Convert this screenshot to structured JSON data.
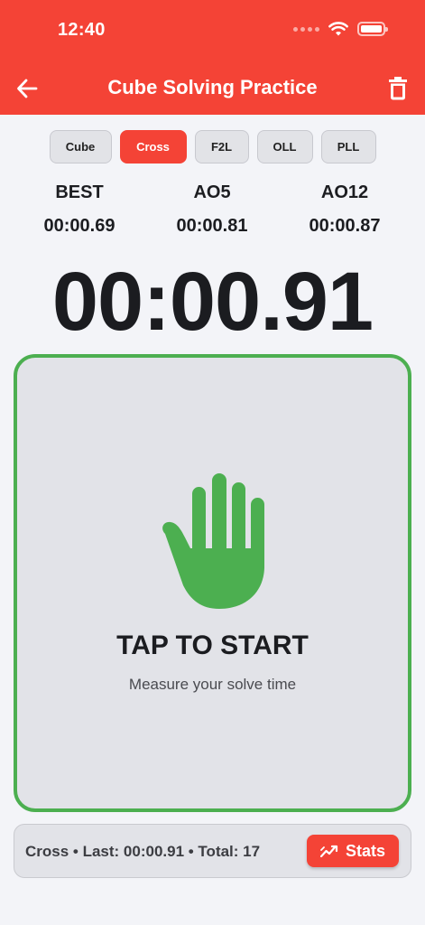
{
  "status_bar": {
    "time": "12:40"
  },
  "header": {
    "title": "Cube Solving Practice"
  },
  "segments": [
    "Cube",
    "Cross",
    "F2L",
    "OLL",
    "PLL"
  ],
  "active_segment": "Cross",
  "stats": {
    "best": {
      "label": "BEST",
      "value": "00:00.69"
    },
    "ao5": {
      "label": "AO5",
      "value": "00:00.81"
    },
    "ao12": {
      "label": "AO12",
      "value": "00:00.87"
    }
  },
  "timer": {
    "display": "00:00.91"
  },
  "tap_area": {
    "title": "TAP TO START",
    "subtitle": "Measure your solve time",
    "icon": "hand-stop-icon",
    "border_color": "#4caf50"
  },
  "footer": {
    "summary": "Cross • Last: 00:00.91  •  Total: 17",
    "stats_button": "Stats"
  },
  "colors": {
    "accent": "#f44336",
    "success": "#4caf50"
  }
}
